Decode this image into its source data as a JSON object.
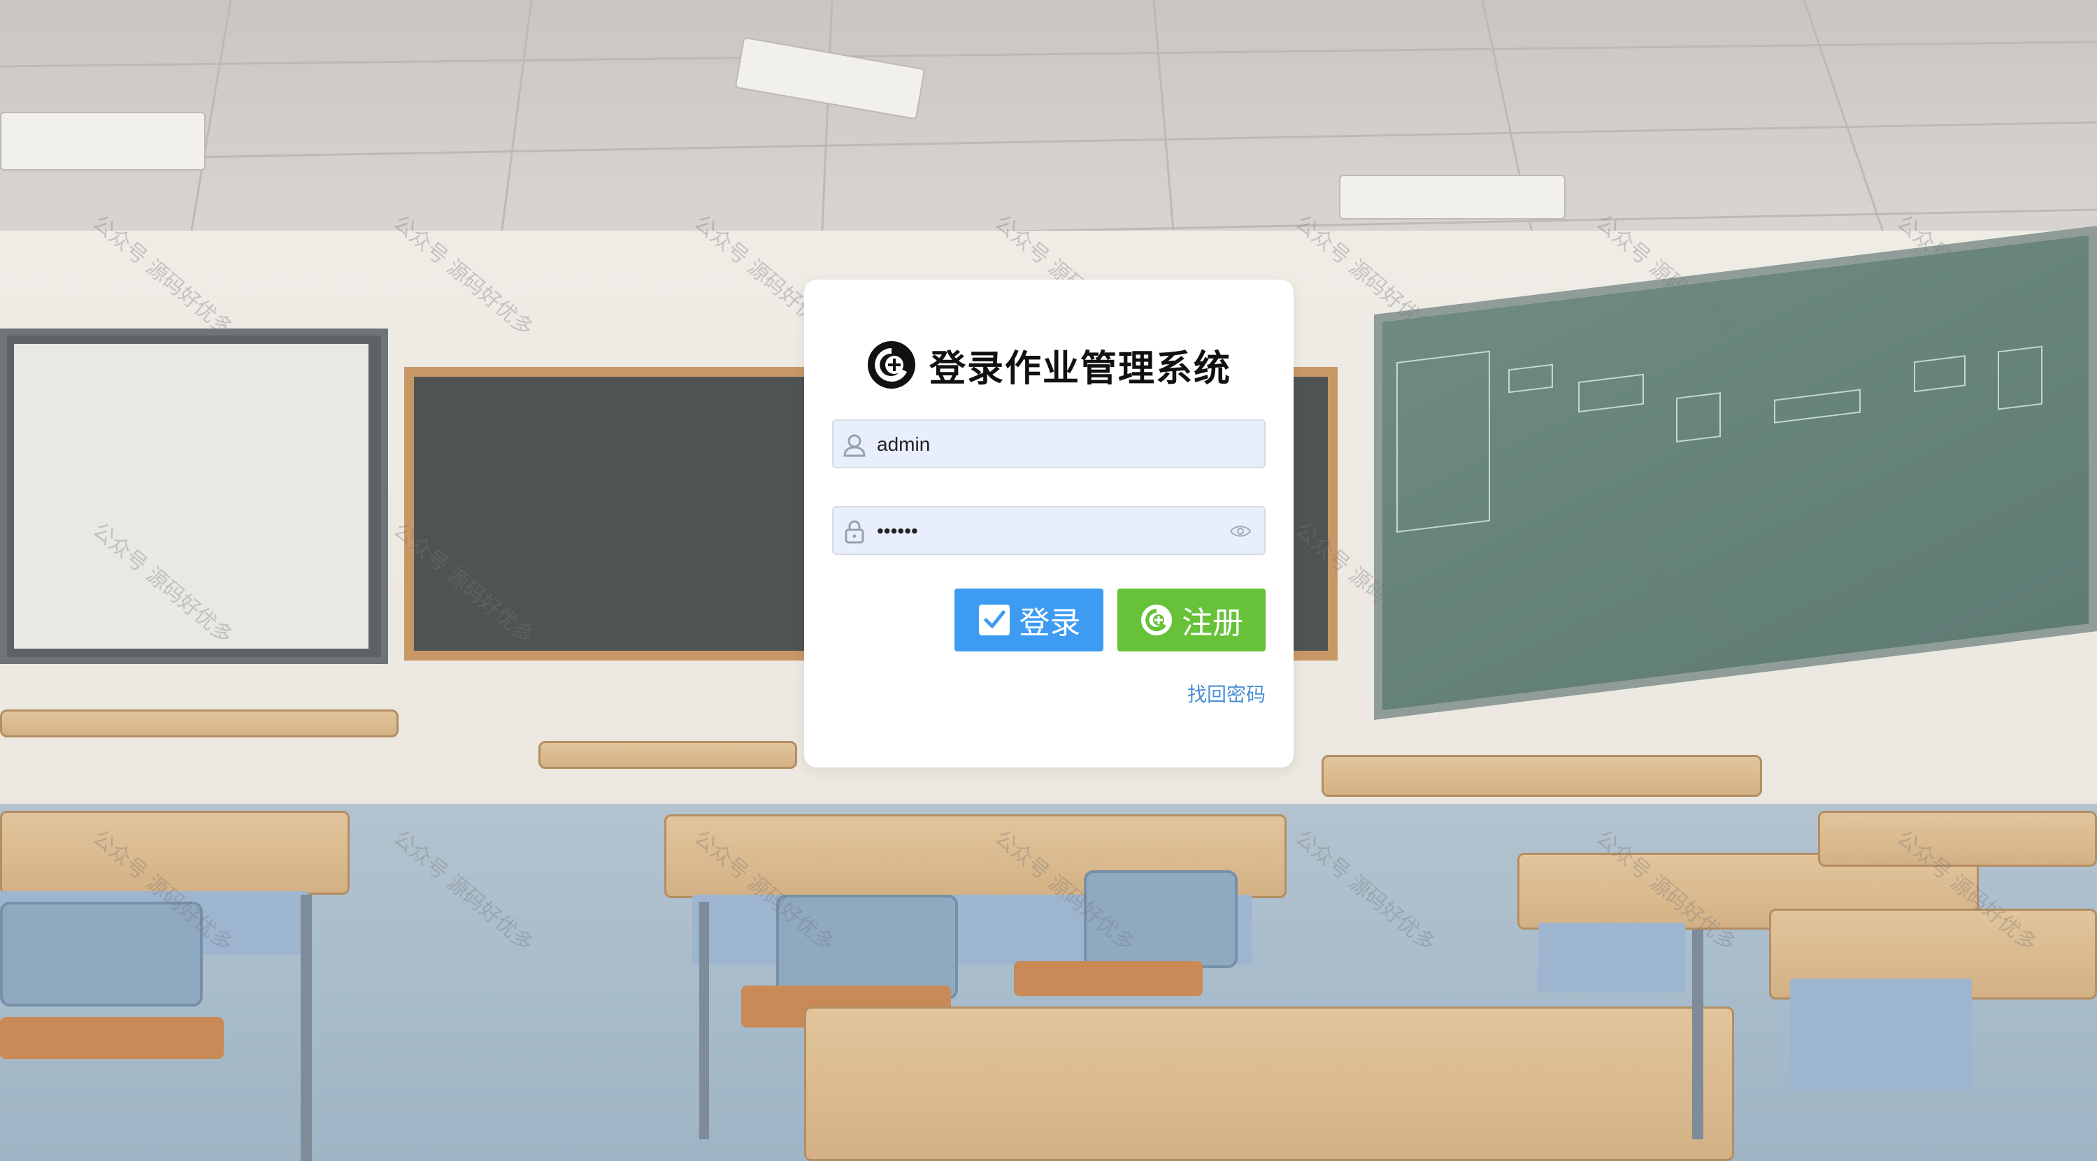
{
  "login": {
    "title": "登录作业管理系统",
    "username_value": "admin",
    "password_value": "••••••",
    "login_label": "登录",
    "register_label": "注册",
    "forgot_label": "找回密码"
  },
  "icons": {
    "logo": "plus-circle-logo-icon",
    "username": "user-icon",
    "password": "lock-icon",
    "show_password": "eye-icon",
    "login": "checkbox-icon",
    "register": "plus-circle-icon"
  },
  "colors": {
    "login_button": "#3d9bf2",
    "register_button": "#67c23a",
    "link": "#4a8fd6",
    "input_bg": "#e8eefb"
  },
  "watermark": "公众号 源码好优多"
}
